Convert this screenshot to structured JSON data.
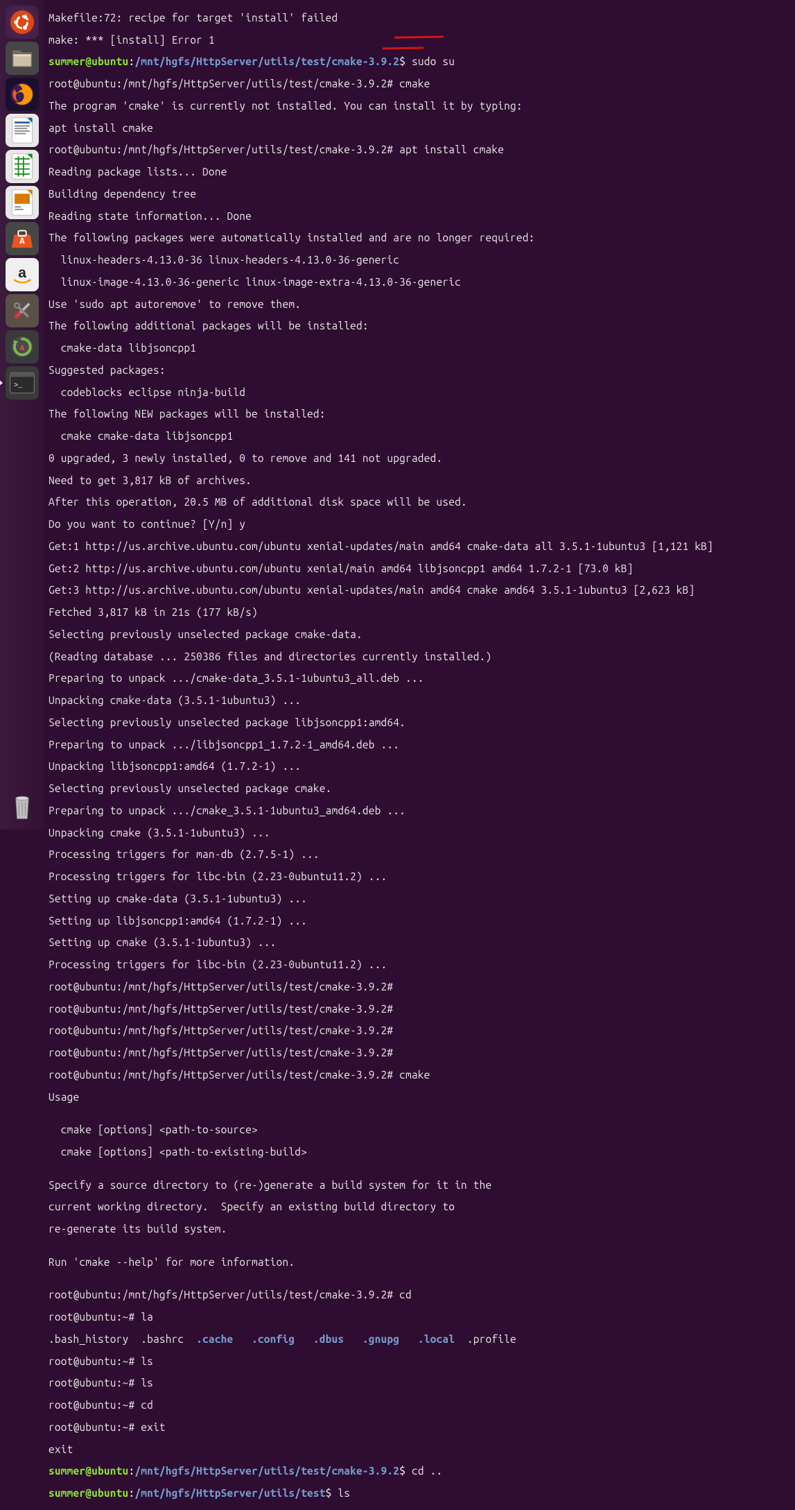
{
  "launcher": {
    "items": [
      {
        "name": "ubuntu-dash",
        "label": "Dash"
      },
      {
        "name": "files",
        "label": "Files"
      },
      {
        "name": "firefox",
        "label": "Firefox"
      },
      {
        "name": "writer",
        "label": "LibreOffice Writer"
      },
      {
        "name": "calc",
        "label": "LibreOffice Calc"
      },
      {
        "name": "impress",
        "label": "LibreOffice Impress"
      },
      {
        "name": "software",
        "label": "Ubuntu Software"
      },
      {
        "name": "amazon",
        "label": "Amazon"
      },
      {
        "name": "settings",
        "label": "System Settings"
      },
      {
        "name": "updater",
        "label": "Software Updater"
      },
      {
        "name": "terminal",
        "label": "Terminal"
      }
    ],
    "trash": {
      "name": "trash",
      "label": "Trash"
    }
  },
  "prompt": {
    "user": "summer@ubuntu",
    "root": "root@ubuntu",
    "path_long": "/mnt/hgfs/HttpServer/utils/test/cmake-3.9.2",
    "path_test": "/mnt/hgfs/HttpServer/utils/test",
    "home": "~"
  },
  "cmds": {
    "sudo_su": "sudo su",
    "cmake": "cmake",
    "apt_install": "apt install cmake",
    "y": "y",
    "cd": "cd",
    "la": "la",
    "ls": "ls",
    "exit": "exit",
    "cd_up": "cd .."
  },
  "term": {
    "l01": "Makefile:72: recipe for target 'install' failed",
    "l02": "make: *** [install] Error 1",
    "l05": "The program 'cmake' is currently not installed. You can install it by typing:",
    "l06": "apt install cmake",
    "l08": "Reading package lists... Done",
    "l09": "Building dependency tree       ",
    "l10": "Reading state information... Done",
    "l11": "The following packages were automatically installed and are no longer required:",
    "l12": "  linux-headers-4.13.0-36 linux-headers-4.13.0-36-generic",
    "l13": "  linux-image-4.13.0-36-generic linux-image-extra-4.13.0-36-generic",
    "l14": "Use 'sudo apt autoremove' to remove them.",
    "l15": "The following additional packages will be installed:",
    "l16": "  cmake-data libjsoncpp1",
    "l17": "Suggested packages:",
    "l18": "  codeblocks eclipse ninja-build",
    "l19": "The following NEW packages will be installed:",
    "l20": "  cmake cmake-data libjsoncpp1",
    "l21": "0 upgraded, 3 newly installed, 0 to remove and 141 not upgraded.",
    "l22": "Need to get 3,817 kB of archives.",
    "l23": "After this operation, 20.5 MB of additional disk space will be used.",
    "l24": "Do you want to continue? [Y/n] ",
    "l25": "Get:1 http://us.archive.ubuntu.com/ubuntu xenial-updates/main amd64 cmake-data all 3.5.1-1ubuntu3 [1,121 kB]",
    "l26": "Get:2 http://us.archive.ubuntu.com/ubuntu xenial/main amd64 libjsoncpp1 amd64 1.7.2-1 [73.0 kB]",
    "l27": "Get:3 http://us.archive.ubuntu.com/ubuntu xenial-updates/main amd64 cmake amd64 3.5.1-1ubuntu3 [2,623 kB]",
    "l28": "Fetched 3,817 kB in 21s (177 kB/s)                                             ",
    "l29": "Selecting previously unselected package cmake-data.",
    "l30": "(Reading database ... 250386 files and directories currently installed.)",
    "l31": "Preparing to unpack .../cmake-data_3.5.1-1ubuntu3_all.deb ...",
    "l32": "Unpacking cmake-data (3.5.1-1ubuntu3) ...",
    "l33": "Selecting previously unselected package libjsoncpp1:amd64.",
    "l34": "Preparing to unpack .../libjsoncpp1_1.7.2-1_amd64.deb ...",
    "l35": "Unpacking libjsoncpp1:amd64 (1.7.2-1) ...",
    "l36": "Selecting previously unselected package cmake.",
    "l37": "Preparing to unpack .../cmake_3.5.1-1ubuntu3_amd64.deb ...",
    "l38": "Unpacking cmake (3.5.1-1ubuntu3) ...",
    "l39": "Processing triggers for man-db (2.7.5-1) ...",
    "l40": "Processing triggers for libc-bin (2.23-0ubuntu11.2) ...",
    "l41": "Setting up cmake-data (3.5.1-1ubuntu3) ...",
    "l42": "Setting up libjsoncpp1:amd64 (1.7.2-1) ...",
    "l43": "Setting up cmake (3.5.1-1ubuntu3) ...",
    "l44": "Processing triggers for libc-bin (2.23-0ubuntu11.2) ...",
    "l45": "root@ubuntu:/mnt/hgfs/HttpServer/utils/test/cmake-3.9.2# ",
    "l46": "root@ubuntu:/mnt/hgfs/HttpServer/utils/test/cmake-3.9.2# ",
    "l47": "root@ubuntu:/mnt/hgfs/HttpServer/utils/test/cmake-3.9.2# ",
    "l48": "root@ubuntu:/mnt/hgfs/HttpServer/utils/test/cmake-3.9.2# ",
    "l49": "root@ubuntu:/mnt/hgfs/HttpServer/utils/test/cmake-3.9.2# cmake",
    "l50": "Usage",
    "l51": "",
    "l52": "  cmake [options] <path-to-source>",
    "l53": "  cmake [options] <path-to-existing-build>",
    "l54": "",
    "l55": "Specify a source directory to (re-)generate a build system for it in the",
    "l56": "current working directory.  Specify an existing build directory to",
    "l57": "re-generate its build system.",
    "l58": "",
    "l59": "Run 'cmake --help' for more information.",
    "l60": "",
    "l61": "root@ubuntu:/mnt/hgfs/HttpServer/utils/test/cmake-3.9.2# cd",
    "l62": "root@ubuntu:~# la",
    "la_plain1": ".bash_history  .bashrc  ",
    "la_cache": ".cache",
    "la_config": ".config",
    "la_dbus": ".dbus",
    "la_gnupg": ".gnupg",
    "la_local": ".local",
    "la_profile": "  .profile",
    "l64": "root@ubuntu:~# ls",
    "l65": "root@ubuntu:~# ls",
    "l66": "root@ubuntu:~# cd",
    "l67": "root@ubuntu:~# exit",
    "l68": "exit"
  }
}
